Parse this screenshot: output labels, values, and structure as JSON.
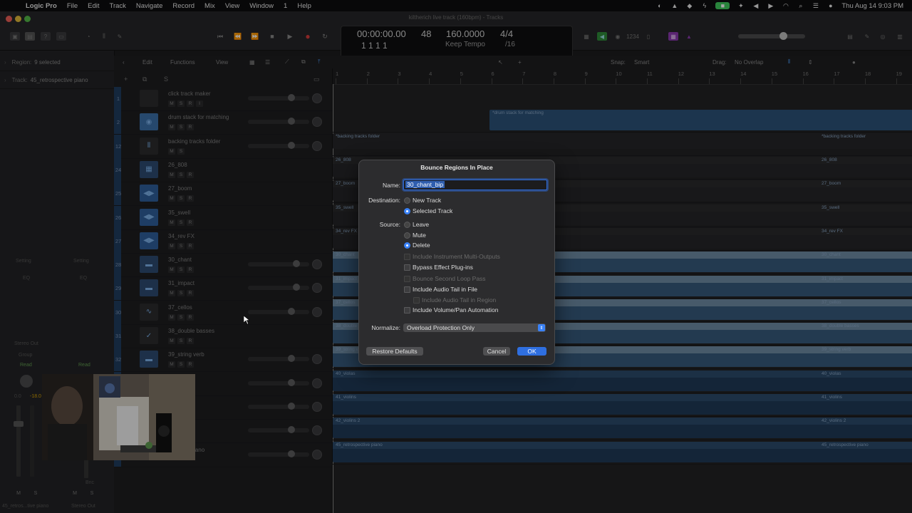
{
  "menubar": {
    "app": "Logic Pro",
    "items": [
      "File",
      "Edit",
      "Track",
      "Navigate",
      "Record",
      "Mix",
      "View",
      "Window",
      "1",
      "Help"
    ],
    "clock": "Thu Aug 14  9:03 PM"
  },
  "window": {
    "title": "kiltherich live track (160bpm) - Tracks"
  },
  "lcd": {
    "time": "00:00:00.00",
    "bar": "48",
    "tempo": "160.0000",
    "signature": "4/4",
    "position": "1  1  1      1",
    "tempo_mode": "Keep Tempo",
    "division": "/16"
  },
  "inspector": {
    "region_label": "Region:",
    "region_value": "9 selected",
    "track_label": "Track:",
    "track_value": "45_retrospective piano",
    "setting_left": "Setting",
    "setting_right": "Setting",
    "eq_left": "EQ",
    "eq_right": "EQ",
    "stereo_out": "Stereo Out",
    "group": "Group",
    "read_left": "Read",
    "read_right": "Read",
    "vol_left": "0.0",
    "vol_left2": "-18.0",
    "bnc": "Bnc",
    "strip_name_left": "45_retros...tive piano",
    "strip_name_right": "Stereo Out",
    "m": "M",
    "s": "S"
  },
  "header_toolbar": {
    "edit": "Edit",
    "functions": "Functions",
    "view": "View",
    "snap_label": "Snap:",
    "snap_value": "Smart",
    "drag_label": "Drag:",
    "drag_value": "No Overlap"
  },
  "tracks": [
    {
      "num": "1",
      "name": "click track maker",
      "btns": [
        "M",
        "S",
        "R",
        "I"
      ]
    },
    {
      "num": "2",
      "name": "drum stack for matching",
      "btns": [
        "M",
        "S",
        "R"
      ]
    },
    {
      "num": "12",
      "name": "backing tracks folder",
      "btns": [
        "M",
        "S"
      ]
    },
    {
      "num": "24",
      "name": "26_808",
      "btns": [
        "M",
        "S",
        "R"
      ]
    },
    {
      "num": "25",
      "name": "27_boom",
      "btns": [
        "M",
        "S",
        "R"
      ]
    },
    {
      "num": "26",
      "name": "35_swell",
      "btns": [
        "M",
        "S",
        "R"
      ]
    },
    {
      "num": "27",
      "name": "34_rev FX",
      "btns": [
        "M",
        "S",
        "R"
      ]
    },
    {
      "num": "28",
      "name": "30_chant",
      "btns": [
        "M",
        "S",
        "R"
      ]
    },
    {
      "num": "29",
      "name": "31_impact",
      "btns": [
        "M",
        "S",
        "R"
      ]
    },
    {
      "num": "30",
      "name": "37_cellos",
      "btns": [
        "M",
        "S",
        "R"
      ]
    },
    {
      "num": "31",
      "name": "38_double basses",
      "btns": [
        "M",
        "S",
        "R"
      ]
    },
    {
      "num": "32",
      "name": "39_string verb",
      "btns": [
        "M",
        "S",
        "R"
      ]
    },
    {
      "num": "",
      "name": "",
      "btns": []
    },
    {
      "num": "",
      "name": "",
      "btns": []
    },
    {
      "num": "",
      "name": "2",
      "btns": []
    },
    {
      "num": "",
      "name": "spective piano",
      "btns": []
    }
  ],
  "ruler": [
    "1",
    "2",
    "3",
    "4",
    "5",
    "6",
    "7",
    "8",
    "9",
    "10",
    "11",
    "12",
    "13",
    "14",
    "15",
    "16",
    "17",
    "18",
    "19"
  ],
  "regions": {
    "drum": "*drum stack for matching",
    "backing": "*backing tracks folder",
    "backing_right": "*backing tracks folder",
    "lanes": [
      {
        "left": "26_808",
        "right": "26_808"
      },
      {
        "left": "27_boom",
        "right": "27_boom"
      },
      {
        "left": "35_swell",
        "right": "35_swell"
      },
      {
        "left": "34_rev FX",
        "right": "34_rev FX"
      },
      {
        "left": "30_chant",
        "right": "30_chant"
      },
      {
        "left": "31_impact",
        "right": "31_impact"
      },
      {
        "left": "37_cellos",
        "right": "37_cellos"
      },
      {
        "left": "38_double basses",
        "right": "38_double basses"
      },
      {
        "left": "39_string verb",
        "right": "39_string verb"
      },
      {
        "left": "40_violas",
        "right": "40_violas"
      },
      {
        "left": "41_violins",
        "right": "41_violins"
      },
      {
        "left": "42_violins 2",
        "right": "42_violins 2"
      },
      {
        "left": "45_retrospective piano",
        "right": "45_retrospective piano"
      }
    ]
  },
  "dialog": {
    "title": "Bounce Regions In Place",
    "name_label": "Name:",
    "name_value": "30_chant_bip",
    "destination_label": "Destination:",
    "dest_new": "New Track",
    "dest_selected": "Selected Track",
    "source_label": "Source:",
    "src_leave": "Leave",
    "src_mute": "Mute",
    "src_delete": "Delete",
    "opt_multi": "Include Instrument Multi-Outputs",
    "opt_bypass": "Bypass Effect Plug-ins",
    "opt_second": "Bounce Second Loop Pass",
    "opt_tail": "Include Audio Tail in File",
    "opt_tail_region": "Include Audio Tail in Region",
    "opt_volpan": "Include Volume/Pan Automation",
    "normalize_label": "Normalize:",
    "normalize_value": "Overload Protection Only",
    "restore": "Restore Defaults",
    "cancel": "Cancel",
    "ok": "OK"
  }
}
